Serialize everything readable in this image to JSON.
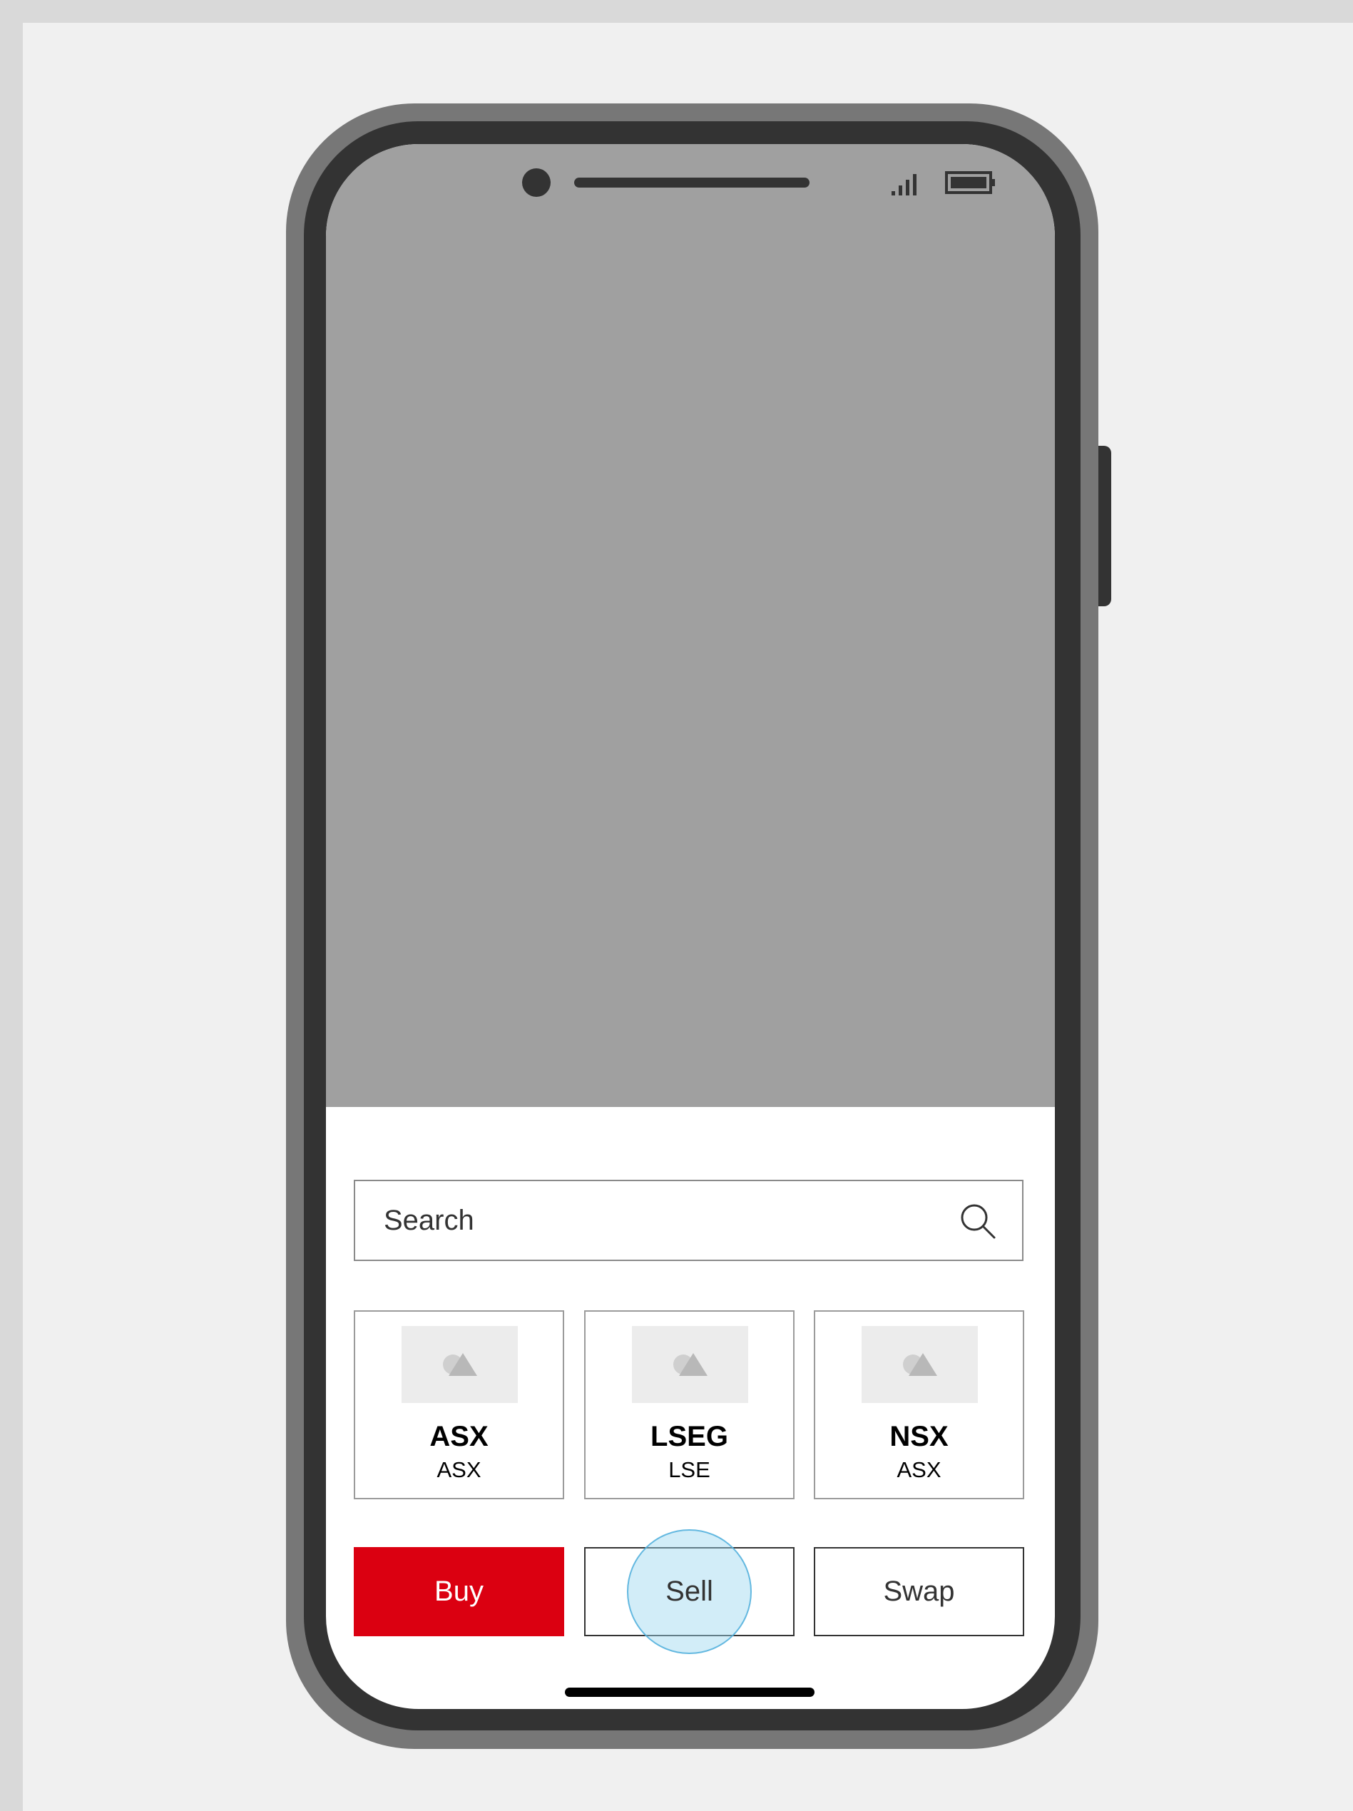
{
  "search": {
    "placeholder": "Search",
    "icon": "search-icon"
  },
  "exchanges": [
    {
      "name": "ASX",
      "code": "ASX",
      "icon": "image-placeholder-icon"
    },
    {
      "name": "LSEG",
      "code": "LSE",
      "icon": "image-placeholder-icon"
    },
    {
      "name": "NSX",
      "code": "ASX",
      "icon": "image-placeholder-icon"
    }
  ],
  "actions": {
    "buy_label": "Buy",
    "sell_label": "Sell",
    "swap_label": "Swap"
  },
  "status_bar": {
    "icons": [
      "camera-icon",
      "speaker-icon",
      "signal-icon",
      "battery-icon"
    ]
  },
  "colors": {
    "primary": "#db0011",
    "screen_placeholder": "#a0a0a0",
    "tap_highlight": "#9bd7f0",
    "phone_frame": "#333333"
  }
}
